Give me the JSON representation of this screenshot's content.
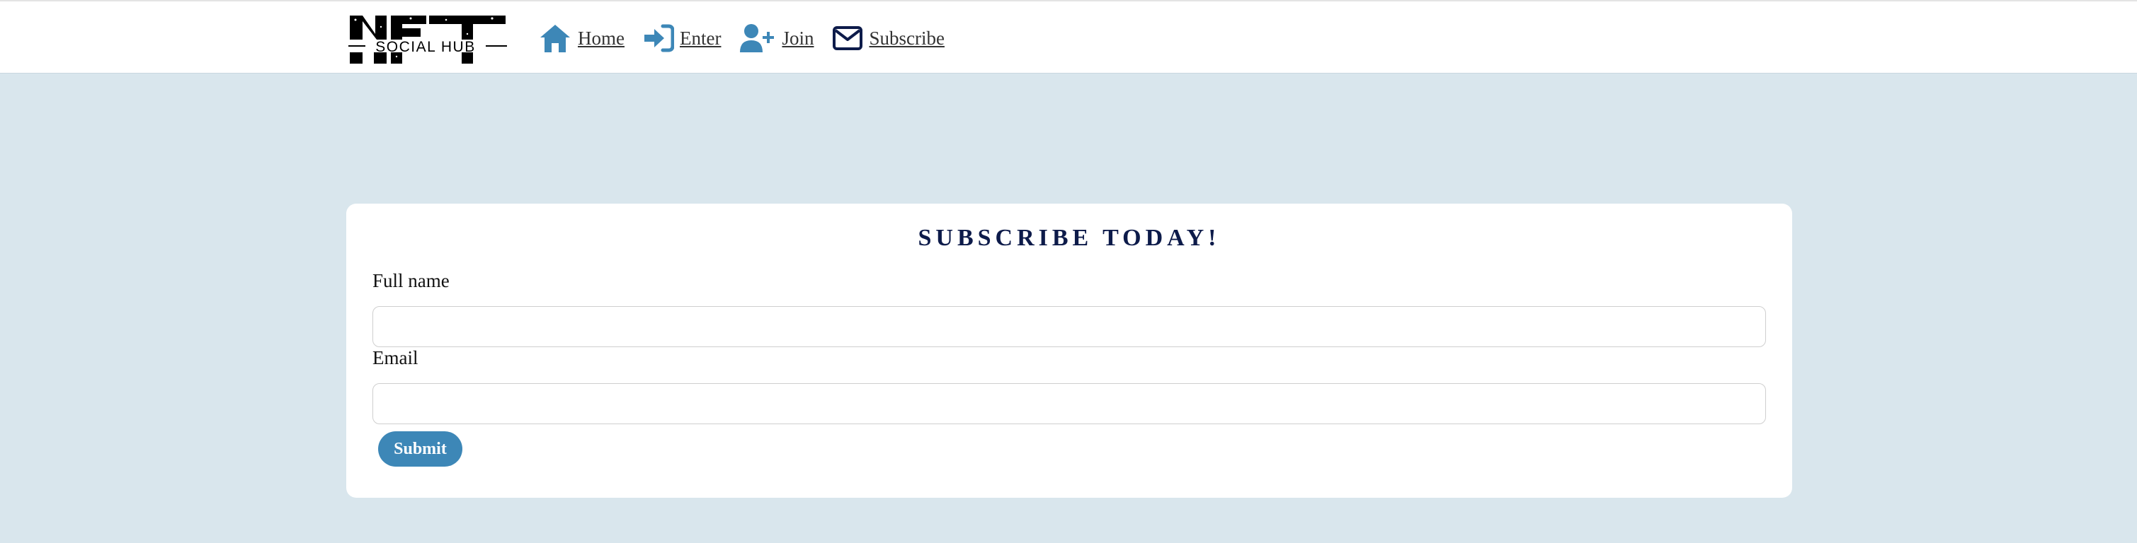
{
  "header": {
    "logo_text_top": "NFT",
    "logo_text_bottom": "SOCIAL HUB",
    "nav": [
      {
        "label": "Home",
        "icon": "home-icon"
      },
      {
        "label": "Enter",
        "icon": "sign-in-icon"
      },
      {
        "label": "Join",
        "icon": "user-plus-icon"
      },
      {
        "label": "Subscribe",
        "icon": "envelope-icon"
      }
    ]
  },
  "form": {
    "title": "SUBSCRIBE TODAY!",
    "fullname_label": "Full name",
    "fullname_value": "",
    "email_label": "Email",
    "email_value": "",
    "submit_label": "Submit"
  },
  "colors": {
    "background": "#d9e6ed",
    "accent": "#3d87b7",
    "title": "#0d1b4a",
    "icon_blue": "#3d87b7",
    "icon_dark": "#0d1b4a"
  }
}
